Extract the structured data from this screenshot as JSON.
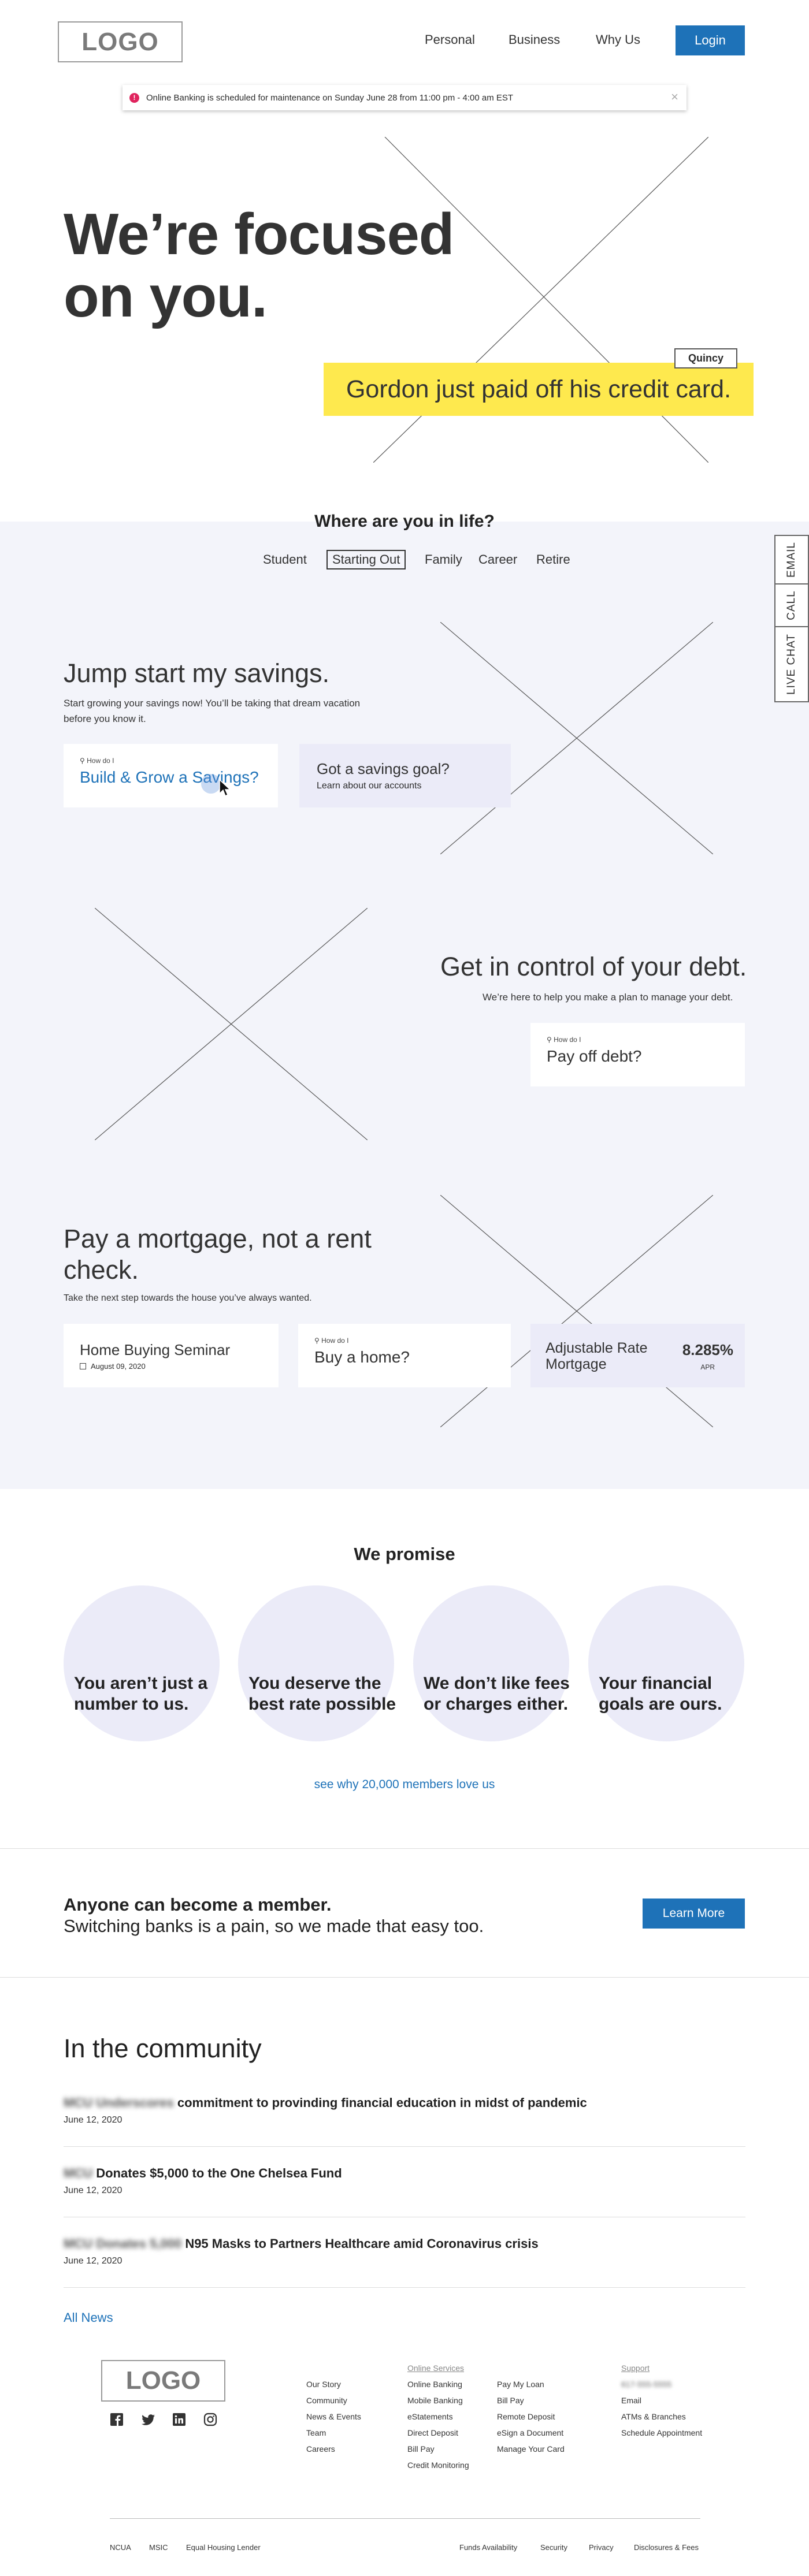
{
  "header": {
    "logo": "LOGO",
    "nav": [
      "Personal",
      "Business",
      "Why Us"
    ],
    "login": "Login"
  },
  "alert": {
    "icon": "!",
    "text": "Online Banking is scheduled for maintenance on Sunday June 28 from 11:00 pm - 4:00 am EST",
    "close": "×"
  },
  "hero": {
    "title_line1": "We’re focused",
    "title_line2": "on you.",
    "tag": "Quincy",
    "banner": "Gordon just paid off his credit card."
  },
  "life": {
    "title": "Where are you in life?",
    "tabs": [
      "Student",
      "Starting Out",
      "Family",
      "Career",
      "Retire"
    ],
    "active_tab": "Starting Out",
    "side_tabs": [
      "EMAIL",
      "CALL",
      "LIVE CHAT"
    ],
    "savings": {
      "title": "Jump start my savings.",
      "subtitle_line1": "Start growing your savings now! You’ll be taking that dream vacation",
      "subtitle_line2": "before you know it.",
      "card1_howdo": "How do I",
      "card1_title": "Build & Grow a Savings?",
      "card2_title": "Got a savings goal?",
      "card2_sub": "Learn about our accounts"
    },
    "debt": {
      "title": "Get in control of your debt.",
      "subtitle": "We’re here to help you make a plan to manage your debt.",
      "card_howdo": "How do I",
      "card_title": "Pay off debt?"
    },
    "mortgage": {
      "title_line1": "Pay a mortgage, not a rent",
      "title_line2": "check.",
      "subtitle": "Take the next step towards the house you’ve always wanted.",
      "seminar_title": "Home Buying Seminar",
      "seminar_date": "August 09, 2020",
      "buy_howdo": "How do I",
      "buy_title": "Buy a home?",
      "rate_title_line1": "Adjustable Rate",
      "rate_title_line2": "Mortgage",
      "rate_value": "8.285%",
      "rate_unit": "APR"
    }
  },
  "promise": {
    "title": "We promise",
    "circles": [
      {
        "line1": "You aren’t just a",
        "line2": "number to us."
      },
      {
        "line1": "You deserve the",
        "line2": "best rate possible"
      },
      {
        "line1": "We don’t like fees",
        "line2": "or charges either."
      },
      {
        "line1": "Your financial",
        "line2": "goals are ours."
      }
    ],
    "link": "see why 20,000 members love us"
  },
  "member": {
    "strong": "Anyone can become a member.",
    "sub": "Switching banks is a pain, so we made that easy too.",
    "button": "Learn More"
  },
  "community": {
    "title": "In the community",
    "news": [
      {
        "blurred": "MCU Underscores",
        "title": "commitment to provinding financial education in midst of pandemic",
        "date": "June 12, 2020"
      },
      {
        "blurred": "MCU",
        "title": "Donates $5,000 to the One Chelsea Fund",
        "date": "June 12, 2020"
      },
      {
        "blurred": "MCU Donates 5,000",
        "title": "N95 Masks to Partners Healthcare amid Coronavirus crisis",
        "date": "June 12, 2020"
      }
    ],
    "all_news": "All News"
  },
  "footer": {
    "logo": "LOGO",
    "col1": [
      "Our Story",
      "Community",
      "News & Events",
      "Team",
      "Careers"
    ],
    "col2_head": "Online Services",
    "col2": [
      "Online Banking",
      "Mobile Banking",
      "eStatements",
      "Direct Deposit",
      "Bill Pay",
      "Credit Monitoring"
    ],
    "col3": [
      "Pay My Loan",
      "Bill Pay",
      "Remote Deposit",
      "eSign a Document",
      "Manage Your Card"
    ],
    "col4_head": "Support",
    "col4_blur": "617-555-5555",
    "col4": [
      "Email",
      "ATMs & Branches",
      "Schedule Appointment"
    ],
    "bottom_left": [
      "NCUA",
      "MSIC",
      "Equal Housing Lender"
    ],
    "bottom_right": [
      "Funds Availability",
      "Security",
      "Privacy",
      "Disclosures & Fees"
    ]
  }
}
